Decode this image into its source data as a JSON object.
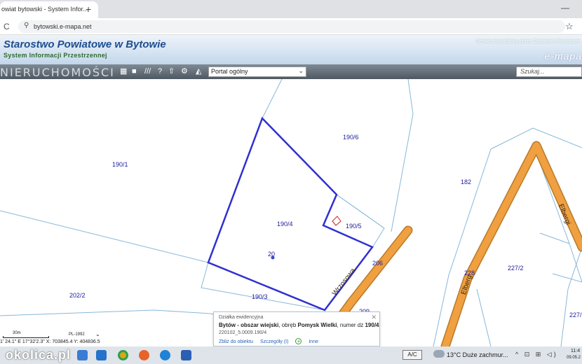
{
  "browser": {
    "tab_title": "owiat bytowski - System Infor...",
    "tab_close": "✕",
    "new_tab": "+",
    "minimize": "—",
    "reload": "C",
    "url": "bytowski.e-mapa.net",
    "bookmark_star": "☆"
  },
  "site": {
    "title": "Starostwo Powiatowe w Bytowie",
    "subtitle": "System Informacji Przestrzennej",
    "serwis": "Serwis prowadzony przez Starostwo Powiatowe",
    "emapa": "e-mapa"
  },
  "toolbar": {
    "wordmark": "NIERUCHOMOŚCI",
    "portal_value": "Portal ogólny",
    "search_placeholder": "Szukaj...",
    "icons": [
      "table-icon",
      "comment-icon",
      "hatch-icon",
      "help-icon",
      "upload-icon",
      "settings-icon",
      "layers-icon"
    ]
  },
  "map": {
    "parcels": {
      "p190_1": "190/1",
      "p190_6": "190/6",
      "p182": "182",
      "p190_4": "190/4",
      "p190_5": "190/5",
      "p206": "206",
      "p20": "20",
      "p227_2": "227/2",
      "p202_2": "202/2",
      "p190_3": "190/3",
      "p209": "209",
      "p227_": "227/",
      "p228": "228"
    },
    "streets": {
      "wrzosowa": "Wrzosowa",
      "elbergi_upper": "Elbergi",
      "elbergi_lower": "Elberg"
    },
    "colors": {
      "selected_outline": "#3030d0",
      "road": "#f0a040",
      "parcel_line": "#88b8d8",
      "label": "#1c1c9c"
    }
  },
  "popup": {
    "title": "Działka ewidencyjna",
    "line1_location": "Bytów - obszar wiejski",
    "line1_obreb_prefix": ", obręb ",
    "line1_obreb": "Pomysk Wielki",
    "line1_numer_prefix": ", numer dz ",
    "line1_numer": "190/4",
    "line2": "220102_5.0009.190/4",
    "link_zoom": "Zbliż do obiektu",
    "link_details": "Szczegóły (I)",
    "link_other": "Inne",
    "close": "✕"
  },
  "scale": {
    "scale_label": "30m",
    "crs": "PL-1992",
    "coords": "1' 24.1\" E  17°32'2.3\"    X: 703845.4   Y: 404836.5"
  },
  "taskbar": {
    "watermark": "okolica.pl",
    "ime": "A/C",
    "weather": "13°C  Duże zachmur...",
    "tray": "^ ⊡ ⊞ ◁)",
    "time": "11:4",
    "date": "09.05.2"
  }
}
